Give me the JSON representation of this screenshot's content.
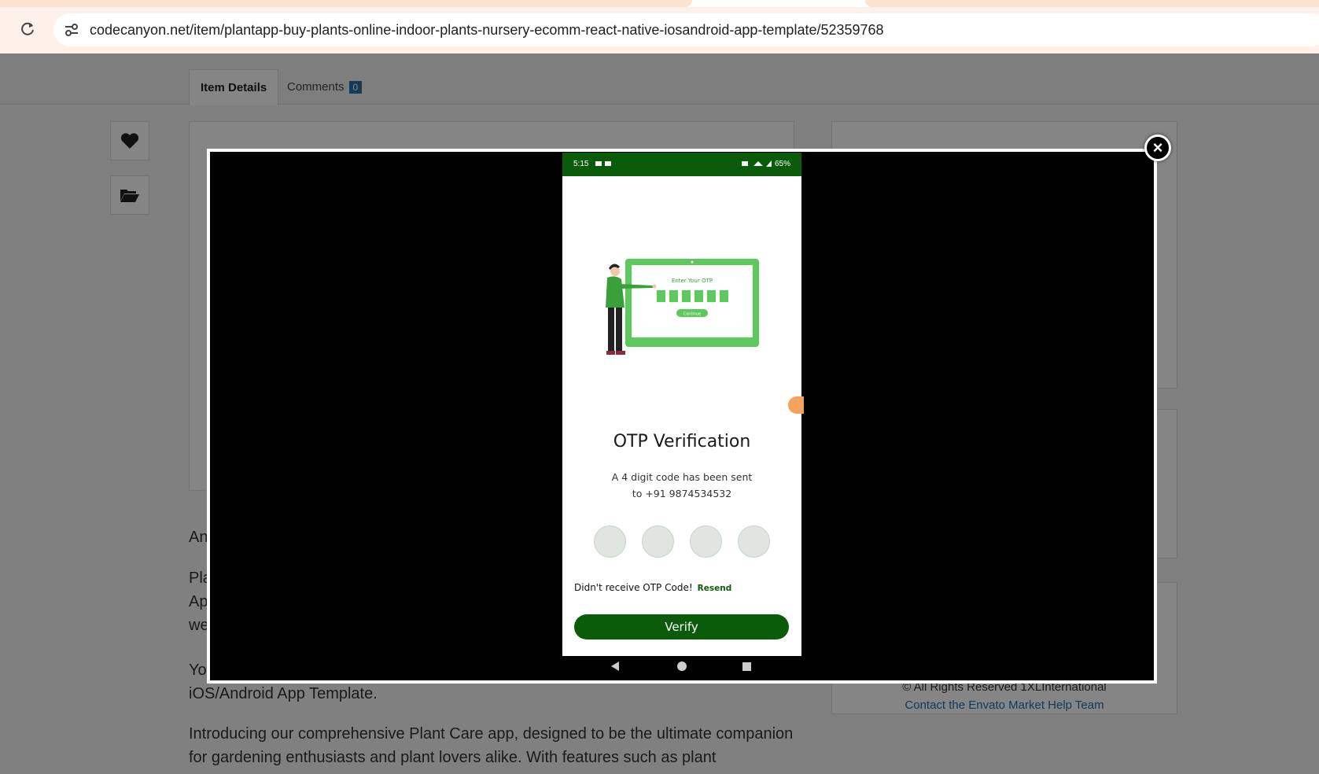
{
  "browser": {
    "url": "codecanyon.net/item/plantapp-buy-plants-online-indoor-plants-nursery-ecomm-react-native-iosandroid-app-template/52359768"
  },
  "page": {
    "tabs": [
      {
        "label": "Item Details"
      },
      {
        "label": "Comments",
        "badge": "0"
      }
    ],
    "description": {
      "p1": "An",
      "p2_lines": [
        "Pla",
        "Ap",
        "we"
      ],
      "p3_line1": "Yo",
      "p3_line2": "iOS/Android App Template.",
      "p4_line1": "Introducing our comprehensive Plant Care app, designed to be the ultimate companion",
      "p4_line2": "for gardening enthusiasts and plant lovers alike. With features such as plant"
    },
    "footer": {
      "copyright": "© All Rights Reserved 1XLInternational",
      "help_link": "Contact the Envato Market Help Team"
    }
  },
  "modal": {
    "close_label": "×",
    "phone": {
      "status_time": "5:15",
      "battery": "65%",
      "illustration": {
        "screen_title": "Enter Your OTP",
        "continue_label": "Continue"
      },
      "title": "OTP Verification",
      "message_line1": "A 4 digit code has been sent",
      "message_line2": "to +91 9874534532",
      "resend_prompt": "Didn't receive OTP Code!",
      "resend_label": "Resend",
      "verify_label": "Verify"
    }
  },
  "colors": {
    "brand_green": "#0a5b0a",
    "accent_green": "#5cc95c",
    "link_blue": "#2a6ea8"
  }
}
